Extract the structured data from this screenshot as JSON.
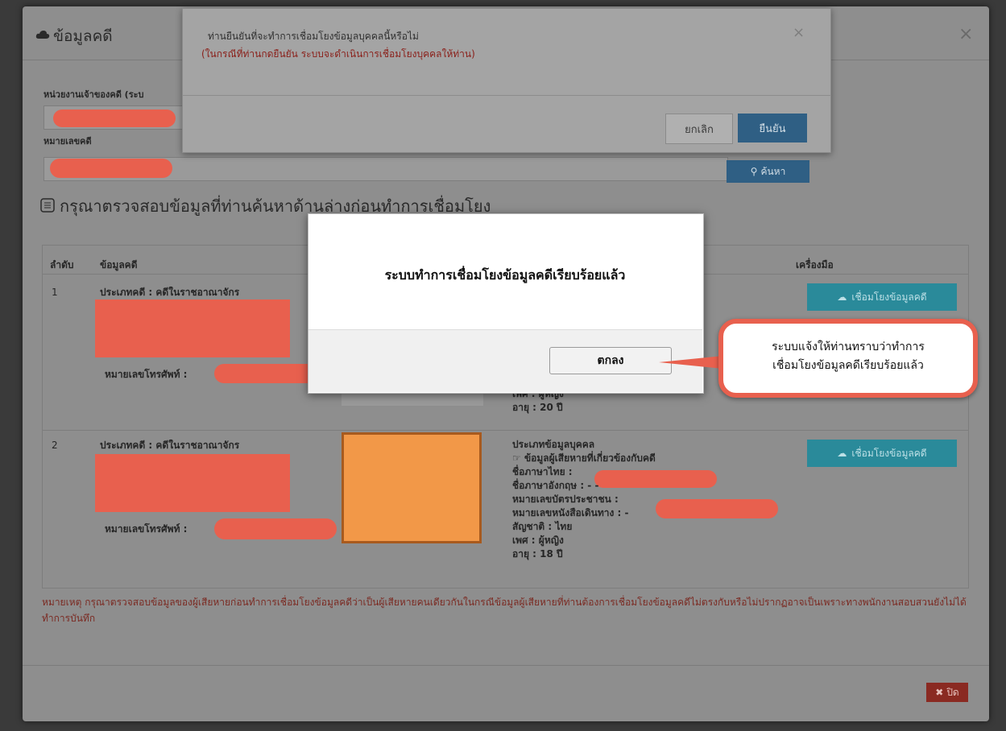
{
  "modal": {
    "title": "ข้อมูลคดี",
    "close": "×",
    "owner_label": "หน่วยงานเจ้าของคดี (ระบ",
    "case_no_label": "หมายเลขคดี",
    "search_button": "ค้นหา",
    "check_heading": "กรุณาตรวจสอบข้อมูลที่ท่านค้นหาด้านล่างก่อนทำการเชื่อมโยง",
    "note": "หมายเหตุ กรุณาตรวจสอบข้อมูลของผู้เสียหายก่อนทำการเชื่อมโยงข้อมูลคดีว่าเป็นผู้เสียหายคนเดียวกันในกรณีข้อมูลผู้เสียหายที่ท่านต้องการเชื่อมโยงข้อมูลคดีไม่ตรงกับหรือไม่ปรากฏอาจเป็นเพราะทางพนักงานสอบสวนยังไม่ได้ทำการบันทึก",
    "close_button": "ปิด"
  },
  "table": {
    "headers": [
      "ลำดับ",
      "ข้อมูลคดี",
      "เครื่องมือ"
    ],
    "rows": [
      {
        "no": "1",
        "case_type": "ประเภทคดี : คดีในราชอาณาจักร",
        "phone_label": "หมายเลขโทรศัพท์ :",
        "info": [
          "เพศ : ผู้หญิง",
          "อายุ : 20 ปี"
        ],
        "link_button": "เชื่อมโยงข้อมูลคดี"
      },
      {
        "no": "2",
        "case_type": "ประเภทคดี : คดีในราชอาณาจักร",
        "phone_label": "หมายเลขโทรศัพท์ :",
        "info": [
          "ประเภทข้อมูลบุคคล",
          "ข้อมูลผู้เสียหายที่เกี่ยวข้องกับคดี",
          "ชื่อภาษาไทย :",
          "ชื่อภาษาอังกฤษ : - -",
          "หมายเลขบัตรประชาชน :",
          "หมายเลขหนังสือเดินทาง : -",
          "สัญชาติ : ไทย",
          "เพศ : ผู้หญิง",
          "อายุ : 18 ปี"
        ],
        "link_button": "เชื่อมโยงข้อมูลคดี"
      }
    ]
  },
  "confirm_dialog": {
    "question": "ท่านยืนยันที่จะทำการเชื่อมโยงข้อมูลบุคคลนี้หรือไม่",
    "subtext": "(ในกรณีที่ท่านกดยืนยัน ระบบจะดำเนินการเชื่อมโยงบุคคลให้ท่าน)",
    "close": "×",
    "cancel": "ยกเลิก",
    "confirm": "ยืนยัน"
  },
  "success_dialog": {
    "message": "ระบบทำการเชื่อมโยงข้อมูลคดีเรียบร้อยแล้ว",
    "ok": "ตกลง"
  },
  "callout": {
    "line1": "ระบบแจ้งให้ท่านทราบว่าทำการ",
    "line2": "เชื่อมโยงข้อมูลคดีเรียบร้อยแล้ว"
  },
  "colors": {
    "redaction": "#e8604e",
    "primary": "#2f5f84",
    "link_button": "#2a8a9a",
    "danger": "#8a2a22",
    "photo": "#f29848"
  }
}
